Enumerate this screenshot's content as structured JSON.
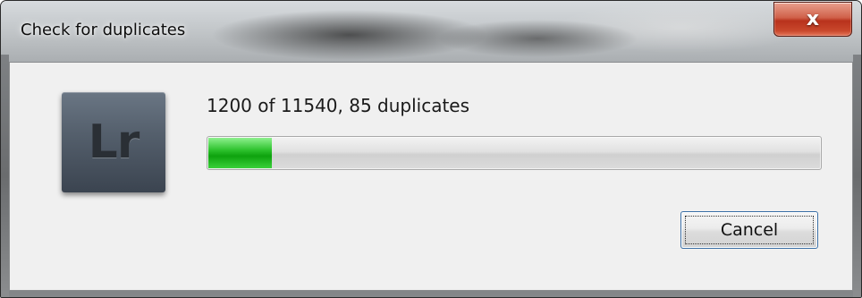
{
  "window": {
    "title": "Check for duplicates",
    "close_glyph": "x"
  },
  "app_icon": {
    "text": "Lr"
  },
  "progress": {
    "status_text": "1200 of 11540, 85 duplicates",
    "fraction": 0.104,
    "fill_color": "#22b522"
  },
  "buttons": {
    "cancel_label": "Cancel"
  }
}
